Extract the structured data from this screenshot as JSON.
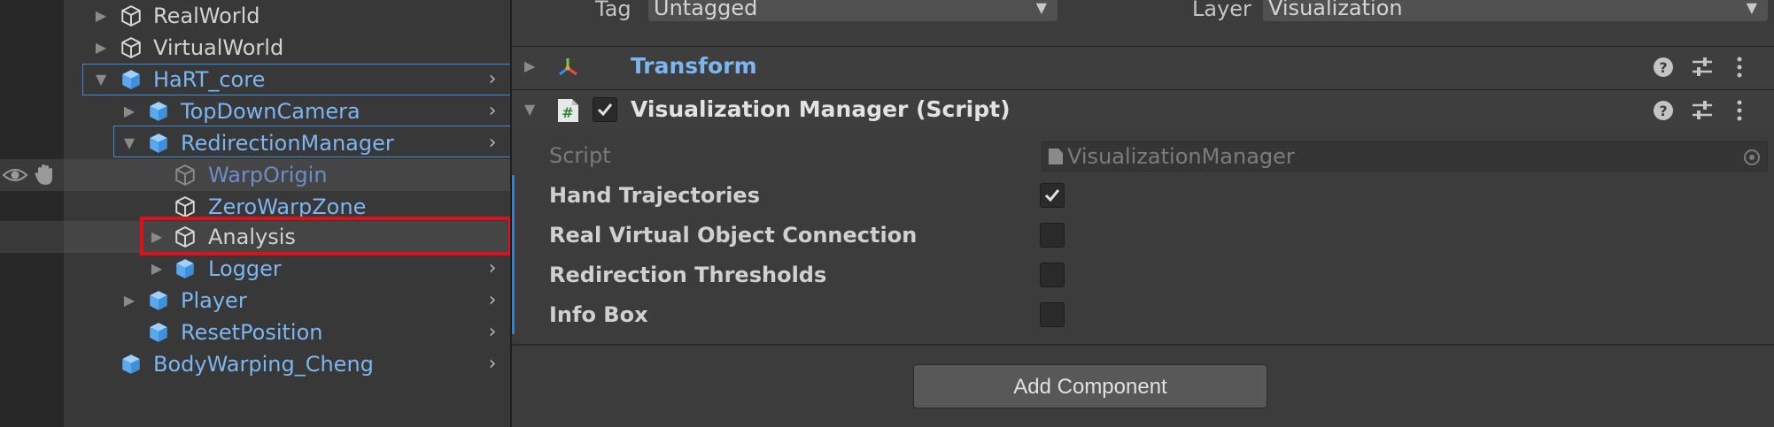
{
  "hierarchy": {
    "items": [
      {
        "label": "RealWorld"
      },
      {
        "label": "VirtualWorld"
      },
      {
        "label": "HaRT_core"
      },
      {
        "label": "TopDownCamera"
      },
      {
        "label": "RedirectionManager"
      },
      {
        "label": "WarpOrigin"
      },
      {
        "label": "ZeroWarpZone"
      },
      {
        "label": "Analysis"
      },
      {
        "label": "Logger"
      },
      {
        "label": "Player"
      },
      {
        "label": "ResetPosition"
      },
      {
        "label": "BodyWarping_Cheng"
      }
    ]
  },
  "inspector": {
    "tag_label": "Tag",
    "tag_value": "Untagged",
    "layer_label": "Layer",
    "layer_value": "Visualization",
    "transform_title": "Transform",
    "component_title": "Visualization Manager (Script)",
    "script_label": "Script",
    "script_value": "VisualizationManager",
    "properties": [
      {
        "label": "Hand Trajectories",
        "checked": true
      },
      {
        "label": "Real Virtual Object Connection",
        "checked": false
      },
      {
        "label": "Redirection Thresholds",
        "checked": false
      },
      {
        "label": "Info Box",
        "checked": false
      }
    ],
    "add_component_label": "Add Component"
  },
  "colors": {
    "accent": "#3b8ad6",
    "selection_outline": "#e0101a",
    "prefab_blue": "#7cb6f0"
  },
  "icons": {
    "gameobject": "cube-outline-icon",
    "prefab": "cube-filled-icon",
    "transform": "axes-icon",
    "script": "hash-icon",
    "help": "question-circle-icon",
    "presets": "sliders-icon",
    "menu": "kebab-menu-icon",
    "visibility": "eye-icon",
    "pickable": "hand-icon"
  }
}
